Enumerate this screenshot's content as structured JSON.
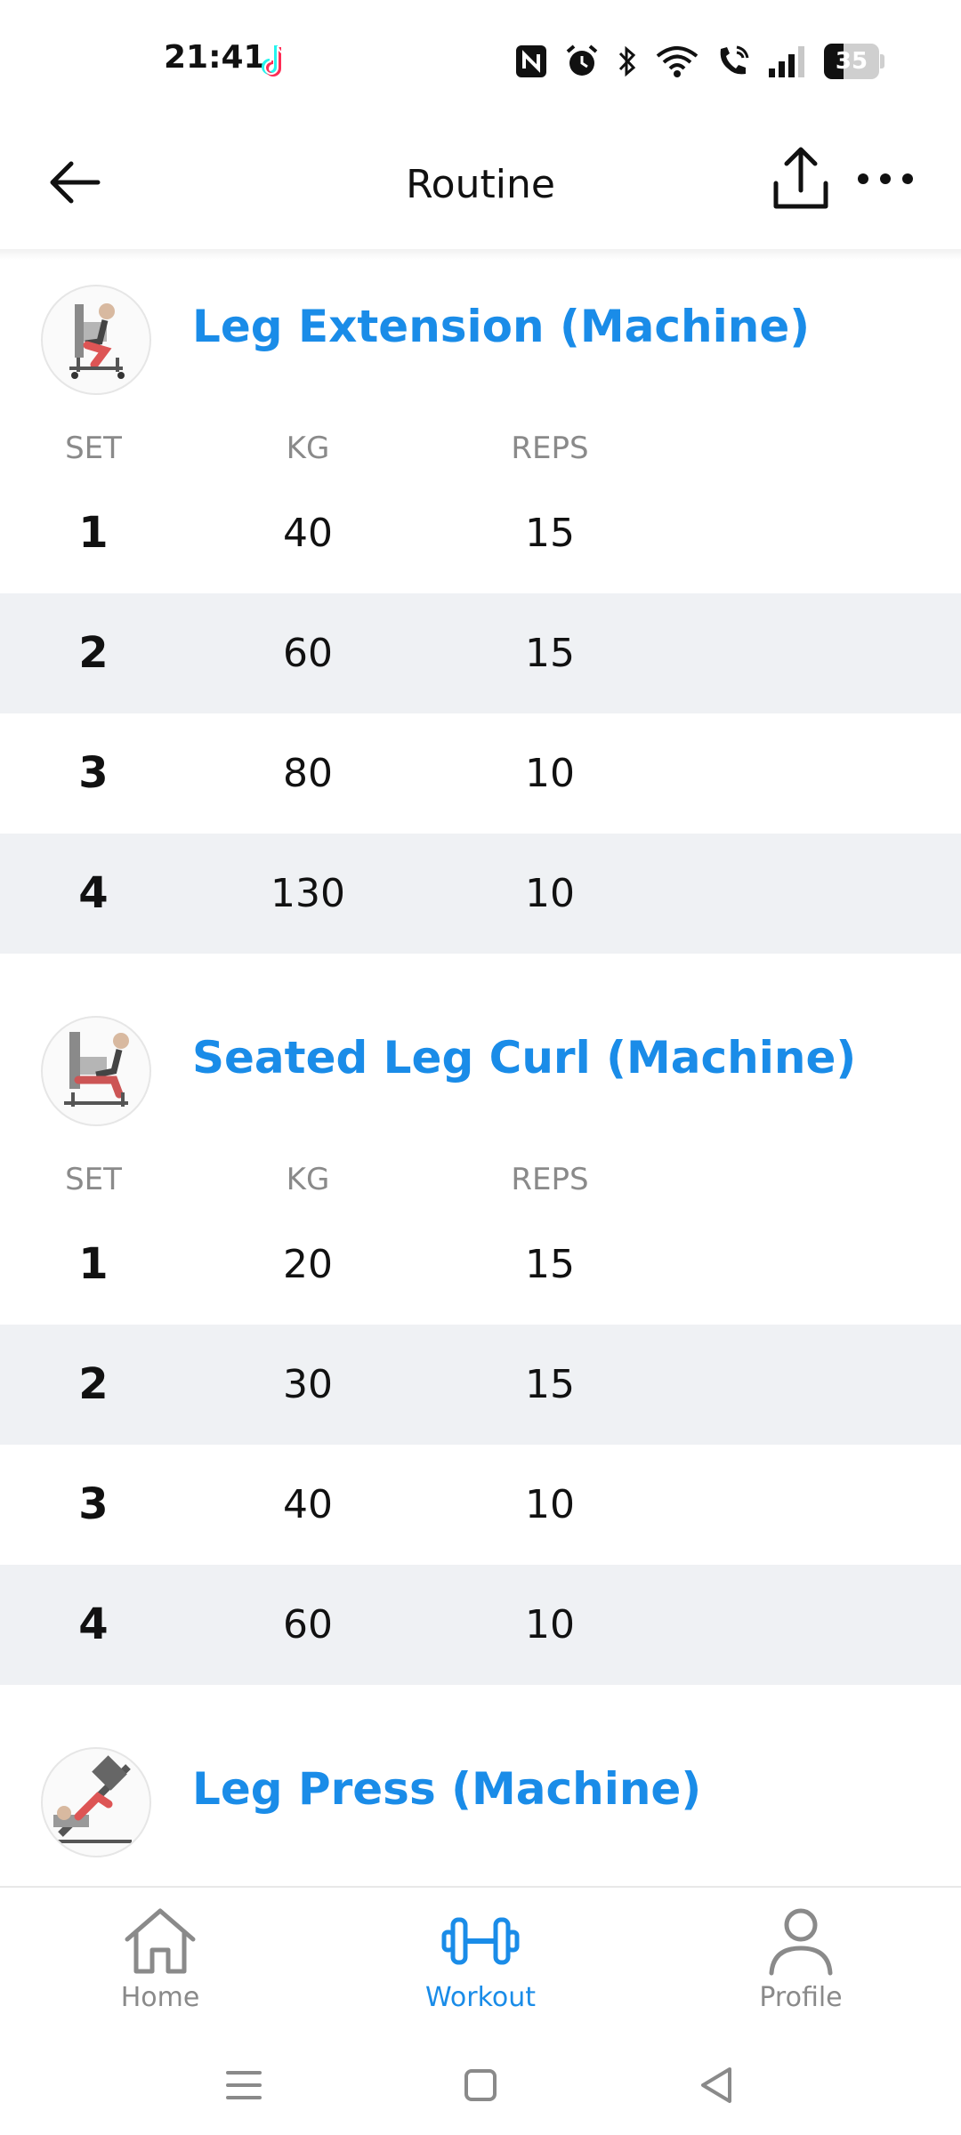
{
  "status_bar": {
    "time": "21:41",
    "battery_level": "35",
    "icons": [
      "tiktok-icon",
      "nfc-icon",
      "alarm-icon",
      "bluetooth-icon",
      "wifi-icon",
      "wifi-call-icon",
      "signal-icon",
      "battery-icon"
    ]
  },
  "header": {
    "title": "Routine",
    "back_icon": "arrow-left-icon",
    "share_icon": "share-icon",
    "more_icon": "more-horizontal-icon"
  },
  "columns": {
    "set": "SET",
    "kg": "KG",
    "reps": "REPS"
  },
  "exercises": [
    {
      "name": "Leg Extension (Machine)",
      "sets": [
        {
          "set": "1",
          "kg": "40",
          "reps": "15"
        },
        {
          "set": "2",
          "kg": "60",
          "reps": "15"
        },
        {
          "set": "3",
          "kg": "80",
          "reps": "10"
        },
        {
          "set": "4",
          "kg": "130",
          "reps": "10"
        }
      ]
    },
    {
      "name": "Seated Leg Curl (Machine)",
      "sets": [
        {
          "set": "1",
          "kg": "20",
          "reps": "15"
        },
        {
          "set": "2",
          "kg": "30",
          "reps": "15"
        },
        {
          "set": "3",
          "kg": "40",
          "reps": "10"
        },
        {
          "set": "4",
          "kg": "60",
          "reps": "10"
        }
      ]
    },
    {
      "name": "Leg Press (Machine)",
      "sets": []
    }
  ],
  "bottom_nav": {
    "items": [
      {
        "label": "Home",
        "icon": "home-icon",
        "active": false
      },
      {
        "label": "Workout",
        "icon": "dumbbell-icon",
        "active": true
      },
      {
        "label": "Profile",
        "icon": "profile-icon",
        "active": false
      }
    ]
  },
  "colors": {
    "accent": "#1a8ce8",
    "row_alt": "#eff1f4",
    "muted": "#8a8a8a"
  },
  "system_nav": [
    "menu-icon",
    "home-square-icon",
    "back-triangle-icon"
  ]
}
